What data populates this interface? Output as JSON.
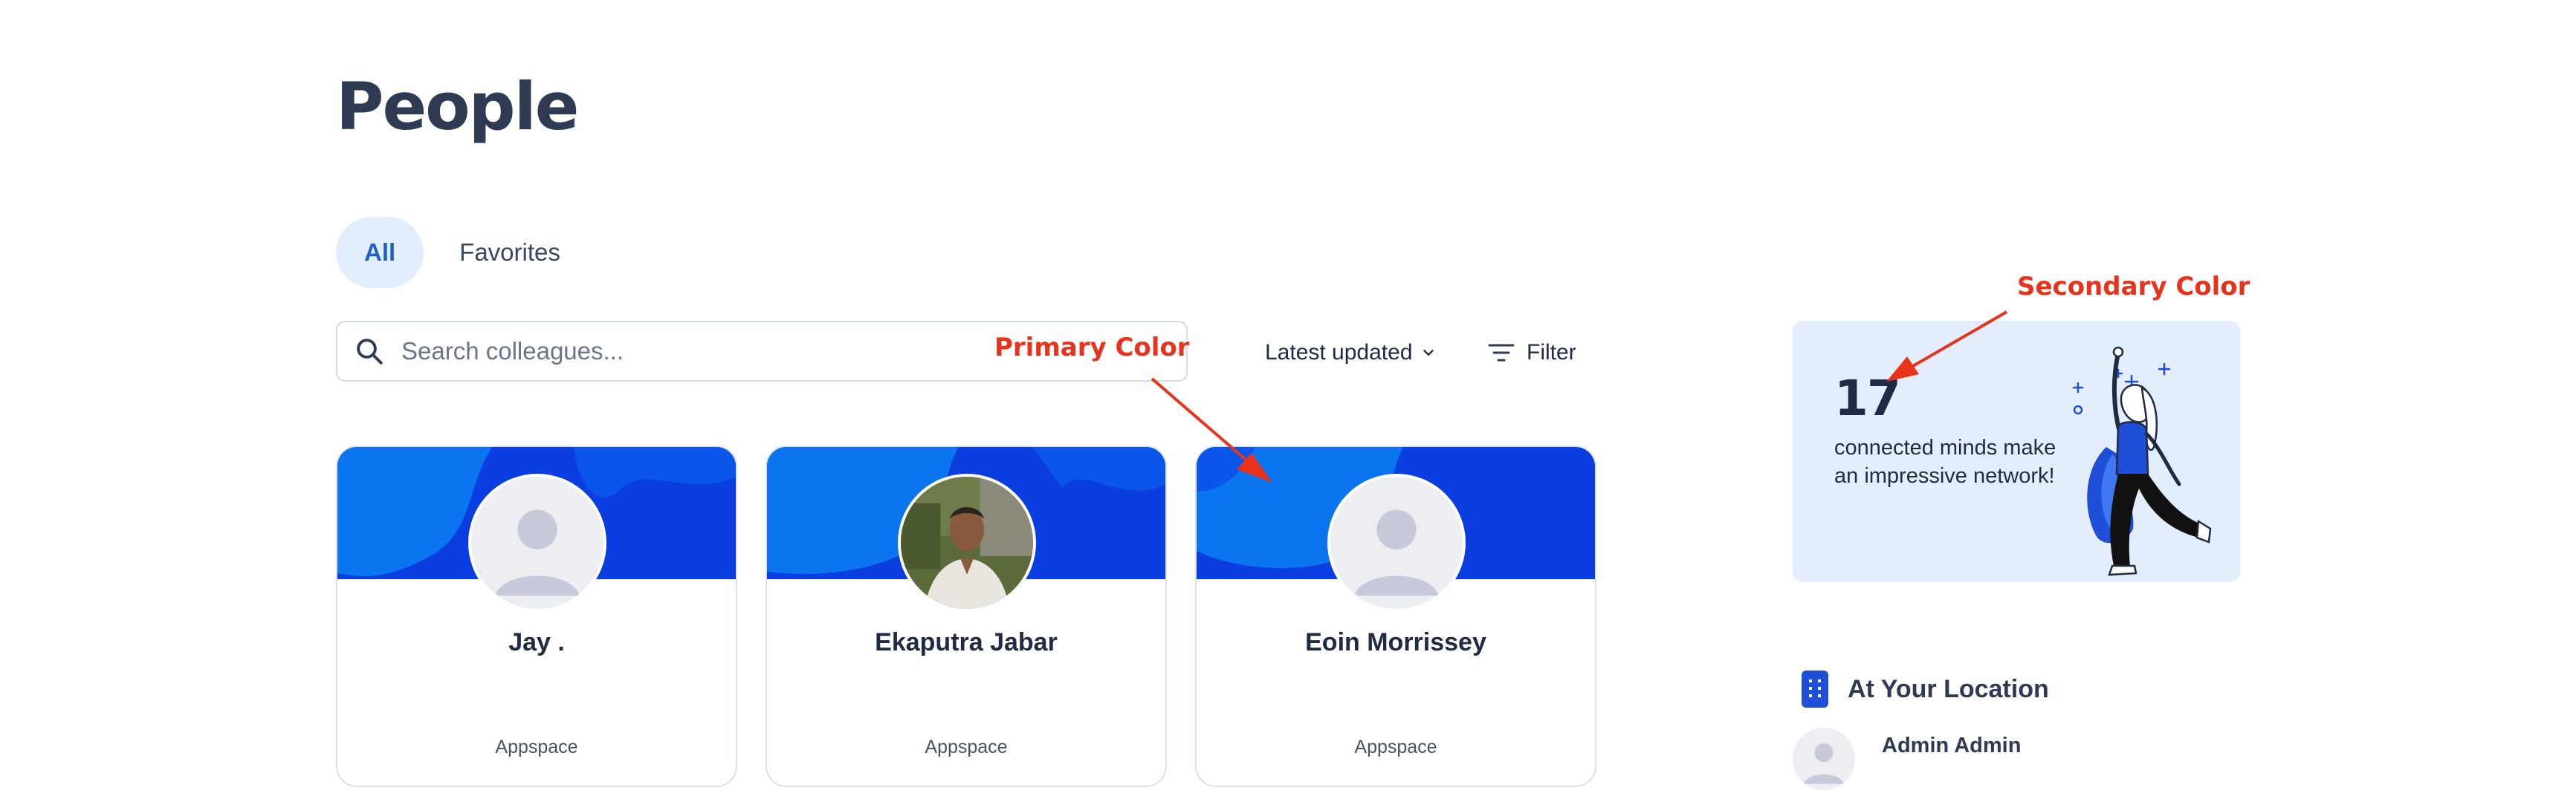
{
  "page": {
    "title": "People"
  },
  "tabs": [
    {
      "label": "All",
      "active": true
    },
    {
      "label": "Favorites",
      "active": false
    }
  ],
  "search": {
    "placeholder": "Search colleagues...",
    "value": ""
  },
  "sort": {
    "label": "Latest updated"
  },
  "filter": {
    "label": "Filter"
  },
  "annotations": {
    "primary": "Primary Color",
    "secondary": "Secondary Color"
  },
  "cards": [
    {
      "name": "Jay .",
      "org": "Appspace",
      "has_photo": false
    },
    {
      "name": "Ekaputra Jabar",
      "org": "Appspace",
      "has_photo": true
    },
    {
      "name": "Eoin Morrissey",
      "org": "Appspace",
      "has_photo": false
    }
  ],
  "stat": {
    "number": "17",
    "text": "connected minds make an impressive network!"
  },
  "location": {
    "title": "At Your Location",
    "people": [
      {
        "name": "Admin Admin"
      }
    ]
  },
  "colors": {
    "primary": "#0a75ee",
    "primary_dark": "#0b3ee0",
    "secondary_bg": "#e4edfb",
    "annotation": "#e8331c"
  }
}
